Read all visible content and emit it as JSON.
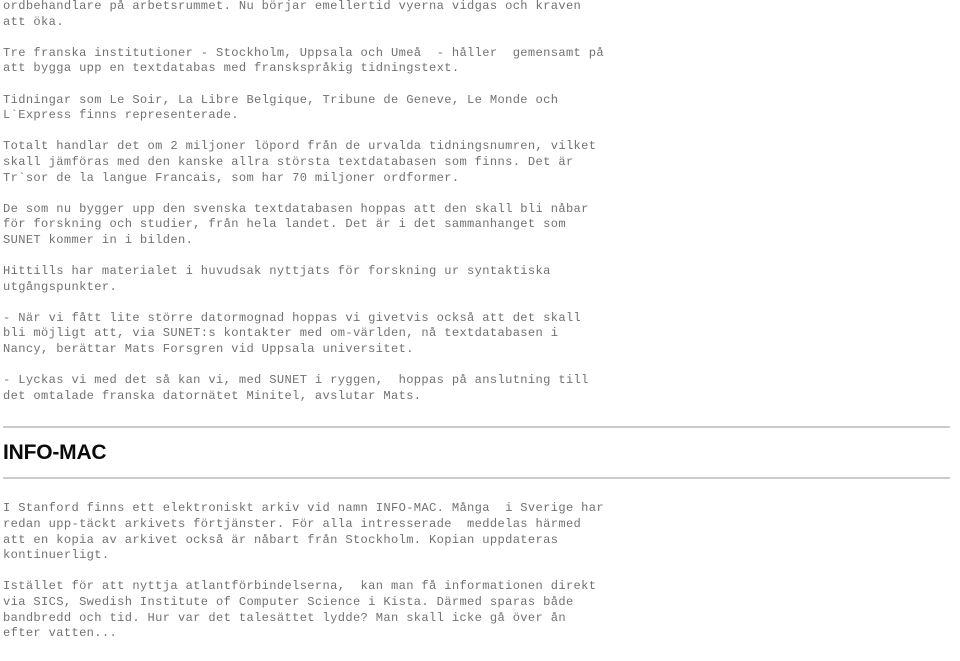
{
  "document": {
    "heading": "INFO-MAC",
    "sections": {
      "before_heading": {
        "paragraphs": [
          {
            "id": "p-ordbehandlare",
            "lines": [
              "ordbehandlare på arbetsrummet. Nu börjar emellertid vyerna vidgas och kraven",
              "att öka."
            ]
          },
          {
            "id": "p-tre-franska",
            "lines": [
              "Tre franska institutioner - Stockholm, Uppsala och Umeå  - håller  gemensamt på",
              "att bygga upp en textdatabas med franskspråkig tidningstext."
            ]
          },
          {
            "id": "p-tidningar",
            "lines": [
              "Tidningar som Le Soir, La Libre Belgique, Tribune de Geneve, Le Monde och",
              "L`Express finns representerade."
            ]
          },
          {
            "id": "p-totalt",
            "lines": [
              "Totalt handlar det om 2 miljoner löpord från de urvalda tidningsnumren, vilket",
              "skall jämföras med den kanske allra största textdatabasen som finns. Det är",
              "Tr`sor de la langue Francais, som har 70 miljoner ordformer."
            ]
          },
          {
            "id": "p-de-som-nu",
            "lines": [
              "De som nu bygger upp den svenska textdatabasen hoppas att den skall bli nåbar",
              "för forskning och studier, från hela landet. Det är i det sammanhanget som",
              "SUNET kommer in i bilden."
            ]
          },
          {
            "id": "p-hittills",
            "lines": [
              "Hittills har materialet i huvudsak nyttjats för forskning ur syntaktiska",
              "utgångspunkter."
            ]
          },
          {
            "id": "p-nar-vi-fatt",
            "lines": [
              "- När vi fått lite större datormognad hoppas vi givetvis också att det skall",
              "bli möjligt att, via SUNET:s kontakter med om-världen, nå textdatabasen i",
              "Nancy, berättar Mats Forsgren vid Uppsala universitet."
            ]
          },
          {
            "id": "p-lyckas",
            "lines": [
              "- Lyckas vi med det så kan vi, med SUNET i ryggen,  hoppas på anslutning till",
              "det omtalade franska datornätet Minitel, avslutar Mats."
            ]
          }
        ]
      },
      "after_heading": {
        "paragraphs": [
          {
            "id": "p-stanford",
            "lines": [
              "I Stanford finns ett elektroniskt arkiv vid namn INFO-MAC. Många  i Sverige har",
              "redan upp-täckt arkivets förtjänster. För alla intresserade  meddelas härmed",
              "att en kopia av arkivet också är nåbart från Stockholm. Kopian uppdateras",
              "kontinuerligt."
            ]
          },
          {
            "id": "p-istallet",
            "lines": [
              "Istället för att nyttja atlantförbindelserna,  kan man få informationen direkt",
              "via SICS, Swedish Institute of Computer Science i Kista. Därmed sparas både",
              "bandbredd och tid. Hur var det talesättet lydde? Man skall icke gå över ån",
              "efter vatten..."
            ]
          }
        ]
      }
    }
  },
  "colors": {
    "body_text": "#6f7274",
    "heading_text": "#0b0b0b",
    "rule": "#c9cbcd",
    "background": "#ffffff"
  }
}
